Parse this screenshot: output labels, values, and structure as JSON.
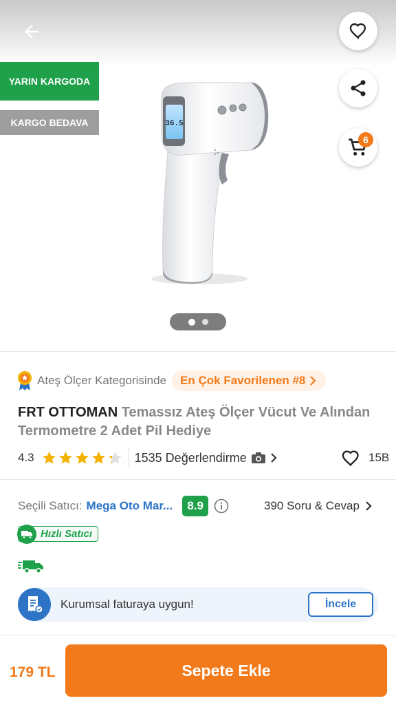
{
  "header": {
    "back_icon": "arrow-left-icon",
    "favorite_icon": "heart-outline-icon",
    "share_icon": "share-icon",
    "cart_icon": "cart-icon",
    "cart_count": "6"
  },
  "badges": {
    "delivery": "YARIN KARGODA",
    "shipping": "KARGO BEDAVA"
  },
  "gallery": {
    "images_count": 2,
    "active_index": 0,
    "thermometer_display": "36.5"
  },
  "category": {
    "text": "Ateş Ölçer Kategorisinde",
    "rank_label": "En Çok Favorilenen #8"
  },
  "product": {
    "brand": "FRT OTTOMAN",
    "name": "Temassız Ateş Ölçer Vücut Ve Alından Termometre 2 Adet Pil Hediye",
    "rating": "4.3",
    "rating_value": 4.3,
    "reviews": "1535 Değerlendirme",
    "favorites": "15B"
  },
  "seller": {
    "label": "Seçili Satıcı:",
    "name": "Mega Oto Mar...",
    "score": "8.9",
    "qa": "390 Soru & Cevap",
    "fast_label": "Hızlı Satıcı"
  },
  "corporate": {
    "text": "Kurumsal faturaya uygun!",
    "button": "İncele"
  },
  "bottom": {
    "price": "179 TL",
    "add_to_cart": "Sepete Ekle"
  },
  "colors": {
    "accent": "#f27a1a",
    "green": "#1ea14a",
    "blue": "#2d73c6",
    "star": "#f5b301"
  }
}
